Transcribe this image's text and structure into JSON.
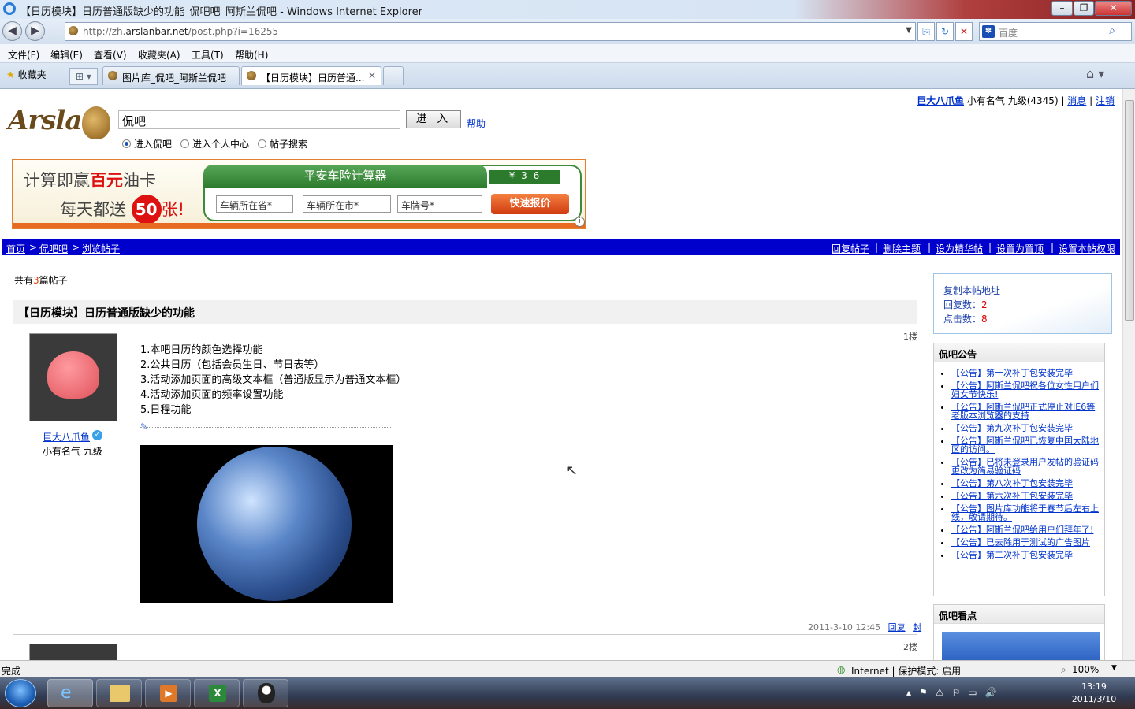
{
  "window": {
    "title": "【日历模块】日历普通版缺少的功能_侃吧吧_阿斯兰侃吧 - Windows Internet Explorer"
  },
  "address": {
    "url_prefix": "http://zh.",
    "url_domain": "arslanbar.net",
    "url_suffix": "/post.php?i=16255",
    "search_placeholder": "百度"
  },
  "menu": [
    "文件(F)",
    "编辑(E)",
    "查看(V)",
    "收藏夹(A)",
    "工具(T)",
    "帮助(H)"
  ],
  "tabs": {
    "favorites": "收藏夹",
    "tab1": "图片库_侃吧_阿斯兰侃吧",
    "tab2": "【日历模块】日历普通..."
  },
  "header": {
    "logo": "Arslan",
    "search_value": "侃吧",
    "enter_button": "进 入",
    "help": "帮助",
    "radios": [
      "进入侃吧",
      "进入个人中心",
      "帖子搜索"
    ],
    "user": {
      "name": "巨大八爪鱼",
      "level_text": "小有名气 九级(4345)",
      "msg": "消息",
      "logout": "注销"
    }
  },
  "ad": {
    "line1a": "计算即赢",
    "line1b": "百元",
    "line1c": "油卡",
    "line2a": "每天都送",
    "line2b": "50",
    "line2c": "张!",
    "calc_title": "平安车险计算器",
    "digits": "¥ 3 6",
    "sel1": "车辆所在省*",
    "sel2": "车辆所在市*",
    "sel3": "车牌号*",
    "button": "快速报价"
  },
  "crumb": {
    "home": "首页",
    "bar": "侃吧吧",
    "current": "浏览帖子",
    "actions": [
      "回复帖子",
      "删除主题",
      "设为精华帖",
      "设置为置顶",
      "设置本帖权限"
    ]
  },
  "post": {
    "count_pre": "共有",
    "count_num": "3",
    "count_post": "篇帖子",
    "title": "【日历模块】日历普通版缺少的功能",
    "floor1": "1楼",
    "author": "巨大八爪鱼",
    "rank": "小有名气 九级",
    "lines": [
      "1.本吧日历的颜色选择功能",
      "2.公共日历（包括会员生日、节日表等）",
      "3.活动添加页面的高级文本框（普通版显示为普通文本框）",
      "4.活动添加页面的频率设置功能",
      "5.日程功能"
    ],
    "time": "2011-3-10 12:45",
    "reply": "回复",
    "ban": "封",
    "floor2": "2楼"
  },
  "sidebar": {
    "copy": "复制本帖地址",
    "reply_label": "回复数：",
    "reply_count": "2",
    "click_label": "点击数：",
    "click_count": "8",
    "notice_title": "侃吧公告",
    "notices": [
      "【公告】第十次补丁包安装完毕",
      "【公告】阿斯兰侃吧祝各位女性用户们妇女节快乐!",
      "【公告】阿斯兰侃吧正式停止对IE6等老版本浏览器的支持",
      "【公告】第九次补丁包安装完毕",
      "【公告】阿斯兰侃吧已恢复中国大陆地区的访问。",
      "【公告】已将未登录用户发帖的验证码更改为简易验证码",
      "【公告】第八次补丁包安装完毕",
      "【公告】第六次补丁包安装完毕",
      "【公告】图片库功能将于春节后左右上线，敬请期待。",
      "【公告】阿斯兰侃吧给用户们拜年了!",
      "【公告】已去除用于测试的广告图片",
      "【公告】第二次补丁包安装完毕"
    ],
    "hot_title": "侃吧看点"
  },
  "status": {
    "left": "完成",
    "zone": "Internet | 保护模式: 启用",
    "zoom": "100%"
  },
  "clock": {
    "time": "13:19",
    "date": "2011/3/10"
  }
}
